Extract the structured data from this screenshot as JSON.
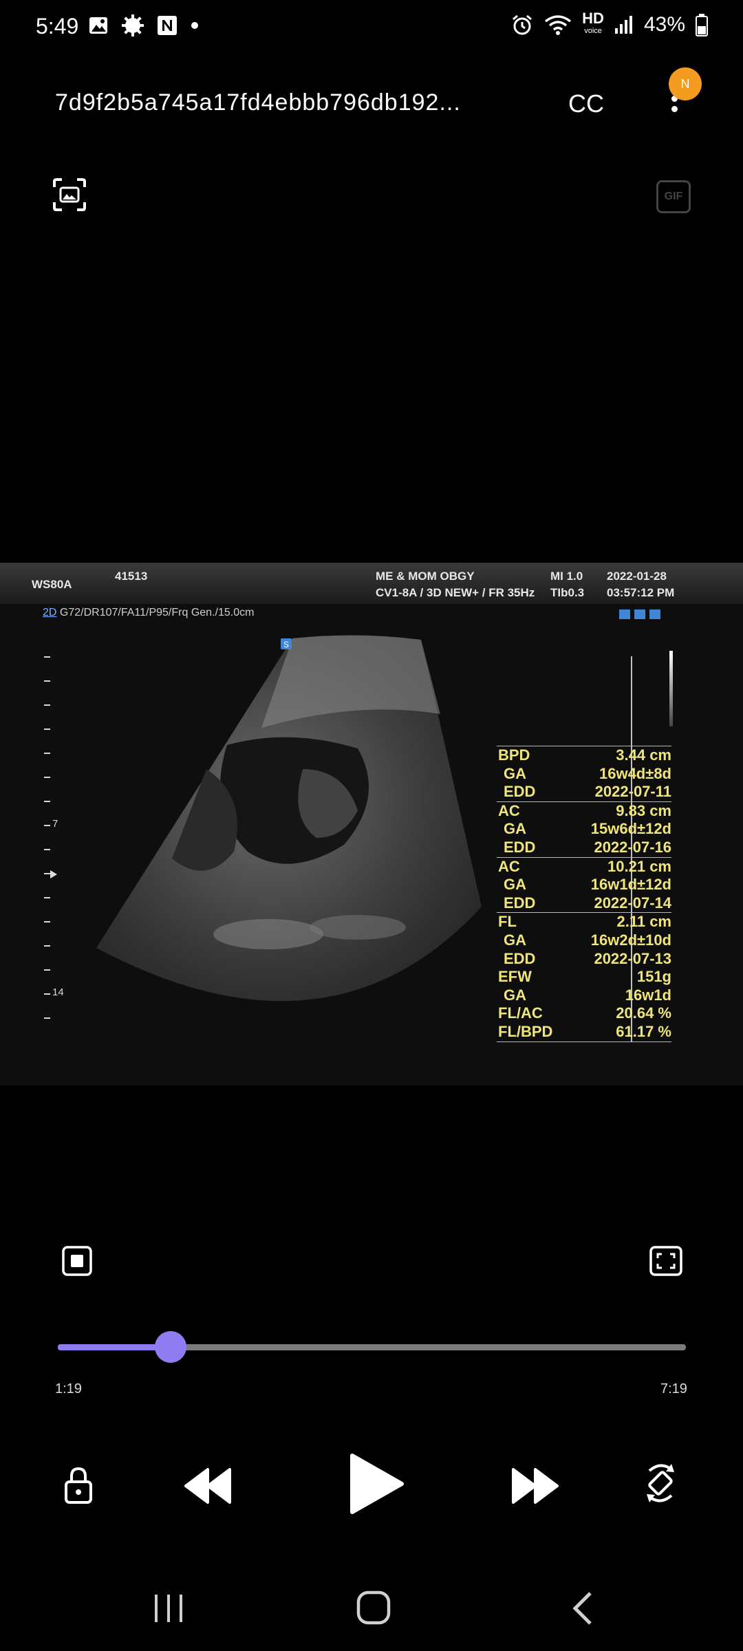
{
  "status_bar": {
    "time": "5:49",
    "hd_label": "HD",
    "hd_sub": "voice",
    "battery": "43%"
  },
  "header": {
    "title": "7d9f2b5a745a17fd4ebbb796db192...",
    "cc_label": "CC",
    "badge_letter": "N"
  },
  "gif_label": "GIF",
  "ultrasound": {
    "device": "WS80A",
    "id": "41513",
    "clinic": "ME & MOM OBGY",
    "probe": "CV1-8A / 3D NEW+ / FR 35Hz",
    "mi": "MI  1.0",
    "tib": "TIb0.3",
    "date": "2022-01-28",
    "clock": "03:57:12 PM",
    "mode": "2D",
    "params": " G72/DR107/FA11/P95/Frq Gen./15.0cm",
    "probe_marker": "S",
    "depth_labels": [
      "7",
      "14"
    ],
    "measurements": [
      {
        "label": "BPD",
        "value": "3.44 cm",
        "indent": false,
        "start": true
      },
      {
        "label": "GA",
        "value": "16w4d±8d",
        "indent": true,
        "start": false
      },
      {
        "label": "EDD",
        "value": "2022-07-11",
        "indent": true,
        "start": false
      },
      {
        "label": "AC",
        "value": "9.83 cm",
        "indent": false,
        "start": true
      },
      {
        "label": "GA",
        "value": "15w6d±12d",
        "indent": true,
        "start": false
      },
      {
        "label": "EDD",
        "value": "2022-07-16",
        "indent": true,
        "start": false
      },
      {
        "label": "AC",
        "value": "10.21 cm",
        "indent": false,
        "start": true
      },
      {
        "label": "GA",
        "value": "16w1d±12d",
        "indent": true,
        "start": false
      },
      {
        "label": "EDD",
        "value": "2022-07-14",
        "indent": true,
        "start": false
      },
      {
        "label": "FL",
        "value": "2.11 cm",
        "indent": false,
        "start": true
      },
      {
        "label": "GA",
        "value": "16w2d±10d",
        "indent": true,
        "start": false
      },
      {
        "label": "EDD",
        "value": "2022-07-13",
        "indent": true,
        "start": false
      },
      {
        "label": "EFW",
        "value": "151g",
        "indent": false,
        "start": false
      },
      {
        "label": "GA",
        "value": "16w1d",
        "indent": true,
        "start": false
      },
      {
        "label": "FL/AC",
        "value": "20.64 %",
        "indent": false,
        "start": false
      },
      {
        "label": "FL/BPD",
        "value": "61.17 %",
        "indent": false,
        "start": false
      }
    ]
  },
  "player": {
    "current_time": "1:19",
    "total_time": "7:19",
    "progress_fraction": 0.18
  },
  "colors": {
    "accent": "#8e7cf0",
    "measure_text": "#f0e57b",
    "badge": "#f39c1f"
  }
}
